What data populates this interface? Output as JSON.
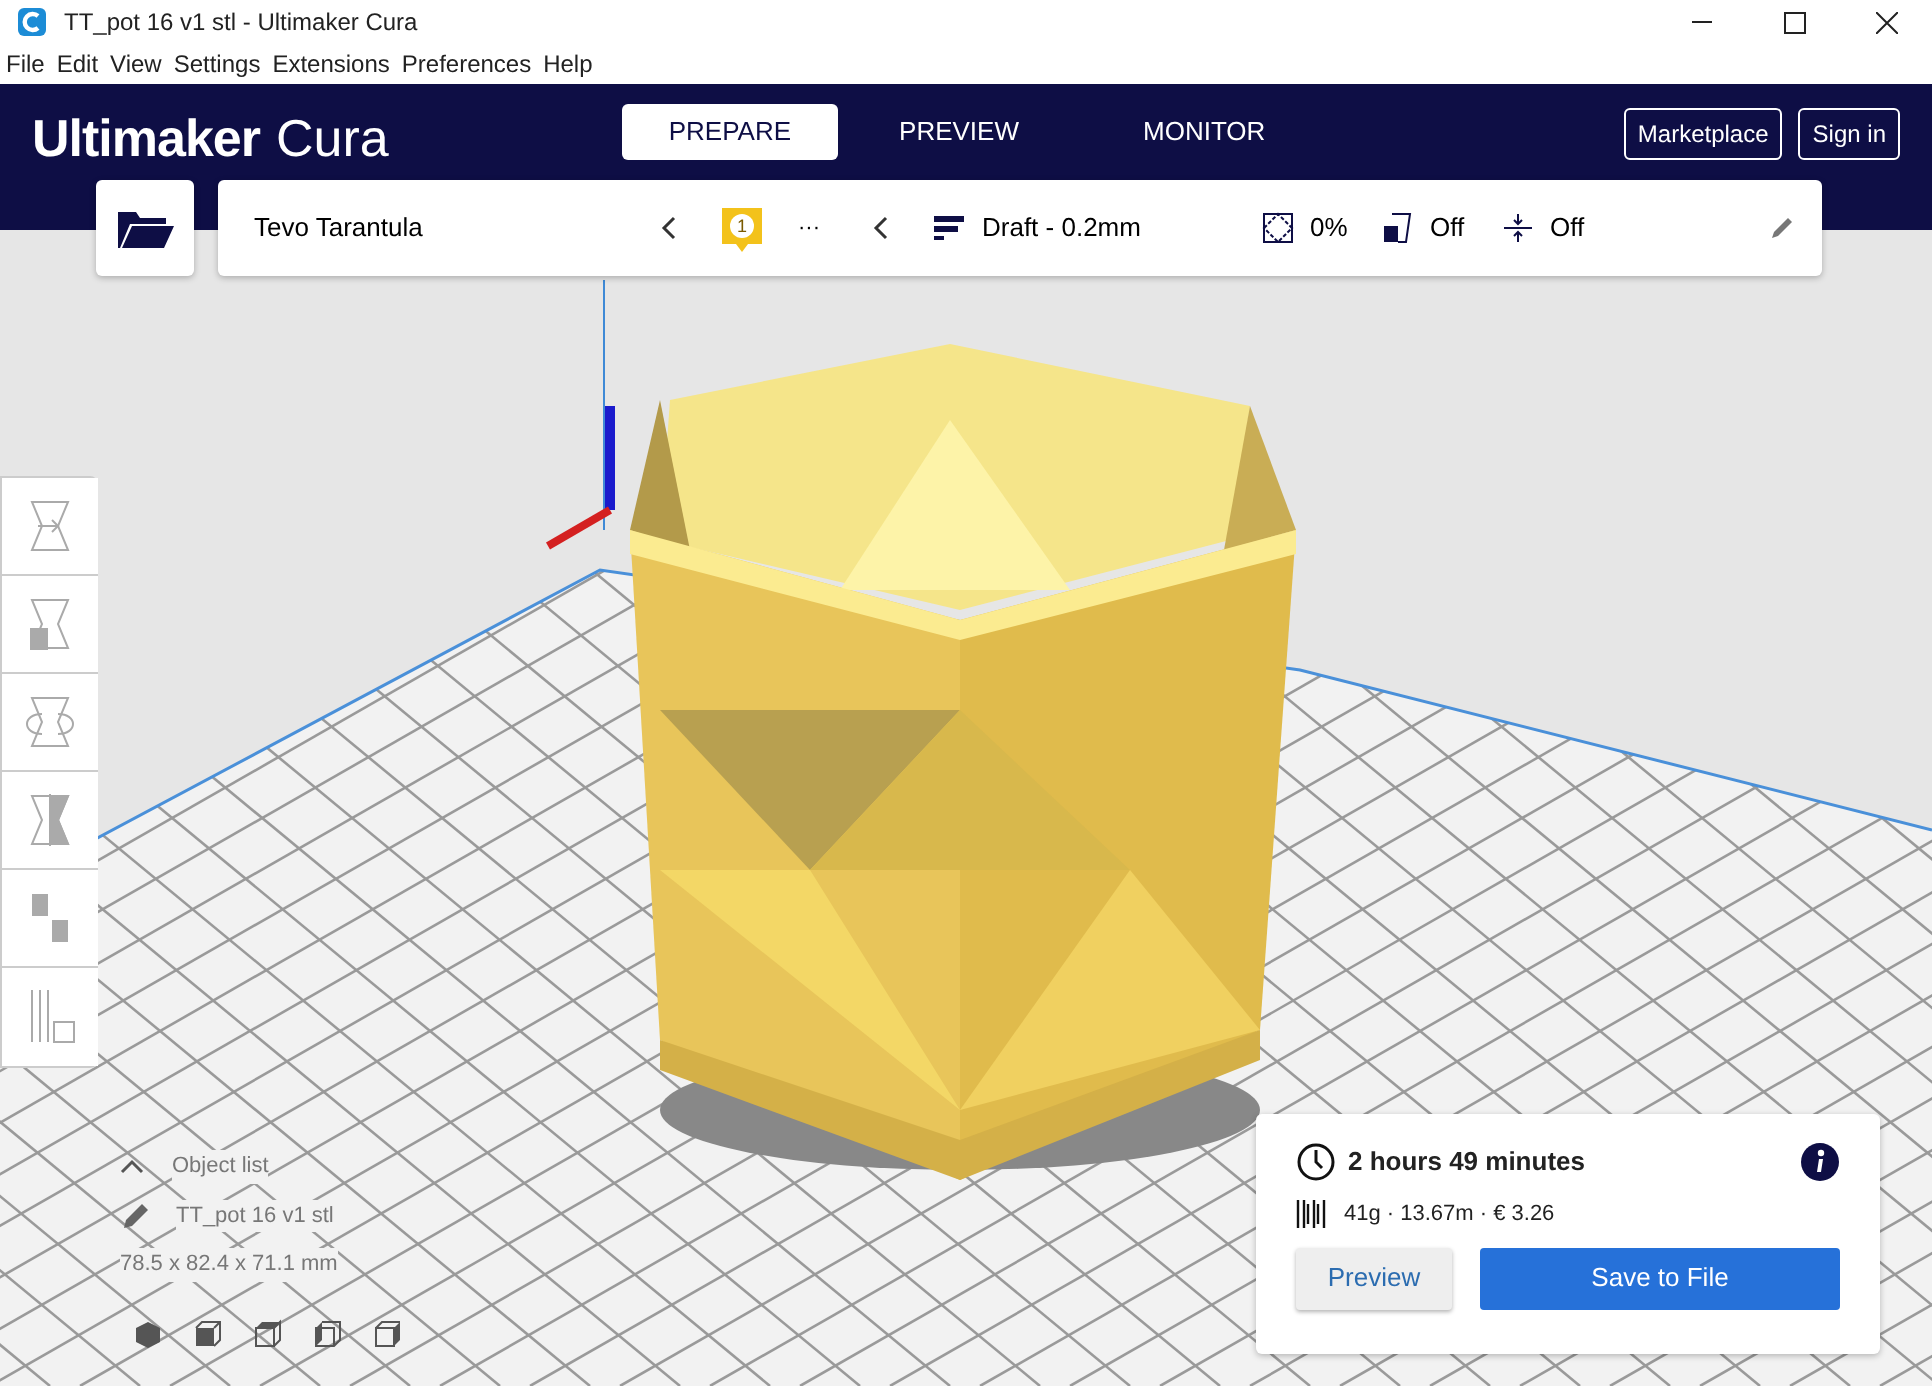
{
  "window": {
    "title": "TT_pot 16  v1 stl  - Ultimaker Cura"
  },
  "menu": [
    "File",
    "Edit",
    "View",
    "Settings",
    "Extensions",
    "Preferences",
    "Help"
  ],
  "header": {
    "brand": "Ultimaker",
    "product": "Cura",
    "stages": [
      {
        "label": "PREPARE",
        "selected": true
      },
      {
        "label": "PREVIEW",
        "selected": false
      },
      {
        "label": "MONITOR",
        "selected": false
      }
    ],
    "buttons": [
      "Marketplace",
      "Sign in"
    ]
  },
  "printer": {
    "name": "Tevo Tarantula"
  },
  "extruder": {
    "badge": "1",
    "label": "···"
  },
  "print_setup": {
    "profile": "Draft - 0.2mm",
    "infill": "0%",
    "support": "Off",
    "adhesion": "Off"
  },
  "tools": [
    {
      "kind": "move"
    },
    {
      "kind": "scale"
    },
    {
      "kind": "rotate"
    },
    {
      "kind": "mirror"
    },
    {
      "kind": "per-model"
    },
    {
      "kind": "support-blocker"
    }
  ],
  "object_list": {
    "label": "Object list",
    "expanded": false,
    "object_name": "TT_pot 16  v1 stl",
    "dimensions": "78.5 x 82.4 x 71.1 mm"
  },
  "view_buttons": [
    {
      "kind": "perspective"
    },
    {
      "kind": "front"
    },
    {
      "kind": "top"
    },
    {
      "kind": "left"
    },
    {
      "kind": "right"
    }
  ],
  "print_info": {
    "time": "2 hours 49 minutes",
    "material": "41g · 13.67m · € 3.26",
    "buttons": [
      {
        "kind": "secondary",
        "label": "Preview"
      },
      {
        "kind": "primary",
        "label": "Save to File"
      }
    ]
  }
}
